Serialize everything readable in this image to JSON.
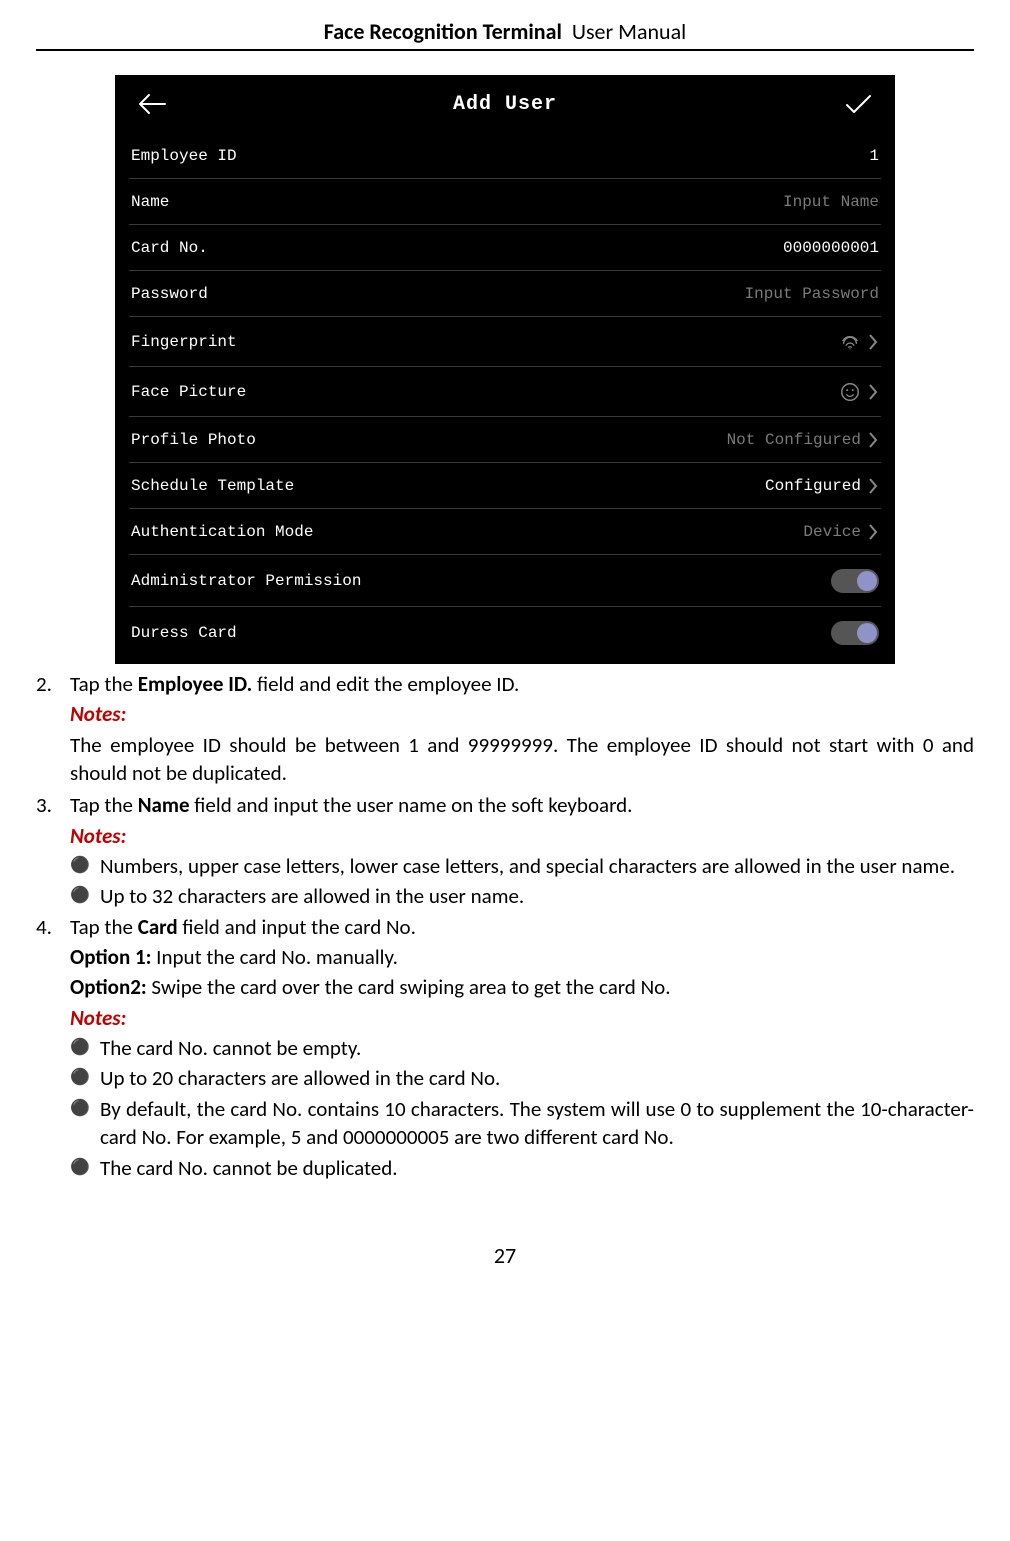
{
  "header": {
    "title_bold": "Face Recognition Terminal",
    "title_thin": "User Manual"
  },
  "page_number": "27",
  "device": {
    "title": "Add User",
    "rows": {
      "employee_id": {
        "label": "Employee ID",
        "value": "1"
      },
      "name": {
        "label": "Name",
        "placeholder": "Input Name"
      },
      "card_no": {
        "label": "Card No.",
        "value": "0000000001"
      },
      "password": {
        "label": "Password",
        "placeholder": "Input Password"
      },
      "fingerprint": {
        "label": "Fingerprint"
      },
      "face": {
        "label": "Face Picture"
      },
      "profile": {
        "label": "Profile Photo",
        "value": "Not Configured"
      },
      "schedule": {
        "label": "Schedule Template",
        "value": "Configured"
      },
      "auth": {
        "label": "Authentication Mode",
        "value": "Device"
      },
      "admin": {
        "label": "Administrator Permission"
      },
      "duress": {
        "label": "Duress Card"
      }
    }
  },
  "body": {
    "step2_num": "2.",
    "step2_a": "Tap the ",
    "step2_b": "Employee ID.",
    "step2_c": " field and edit the employee ID.",
    "notes_label": "Notes:",
    "step2_note": "The employee ID should be between 1 and 99999999. The employee ID should not start with 0 and should not be duplicated.",
    "step3_num": "3.",
    "step3_a": "Tap the ",
    "step3_b": "Name",
    "step3_c": " field and input the user name on the soft keyboard.",
    "step3_bul1": "Numbers, upper case letters, lower case letters, and special characters are allowed in the user name.",
    "step3_bul2": "Up to 32 characters are allowed in the user name.",
    "step4_num": "4.",
    "step4_a": "Tap the ",
    "step4_b": "Card",
    "step4_c": " field and input the card No.",
    "step4_opt1_b": "Option 1:",
    "step4_opt1_t": " Input the card No. manually.",
    "step4_opt2_b": "Option2:",
    "step4_opt2_t": " Swipe the card over the card swiping area to get the card No.",
    "step4_bul1": "The card No. cannot be empty.",
    "step4_bul2": "Up to 20 characters are allowed in the card No.",
    "step4_bul3": "By default, the card No. contains 10 characters. The system will use 0 to supplement the 10-character-card No. For example, 5 and 0000000005 are two different card No.",
    "step4_bul4": "The card No. cannot be duplicated."
  }
}
